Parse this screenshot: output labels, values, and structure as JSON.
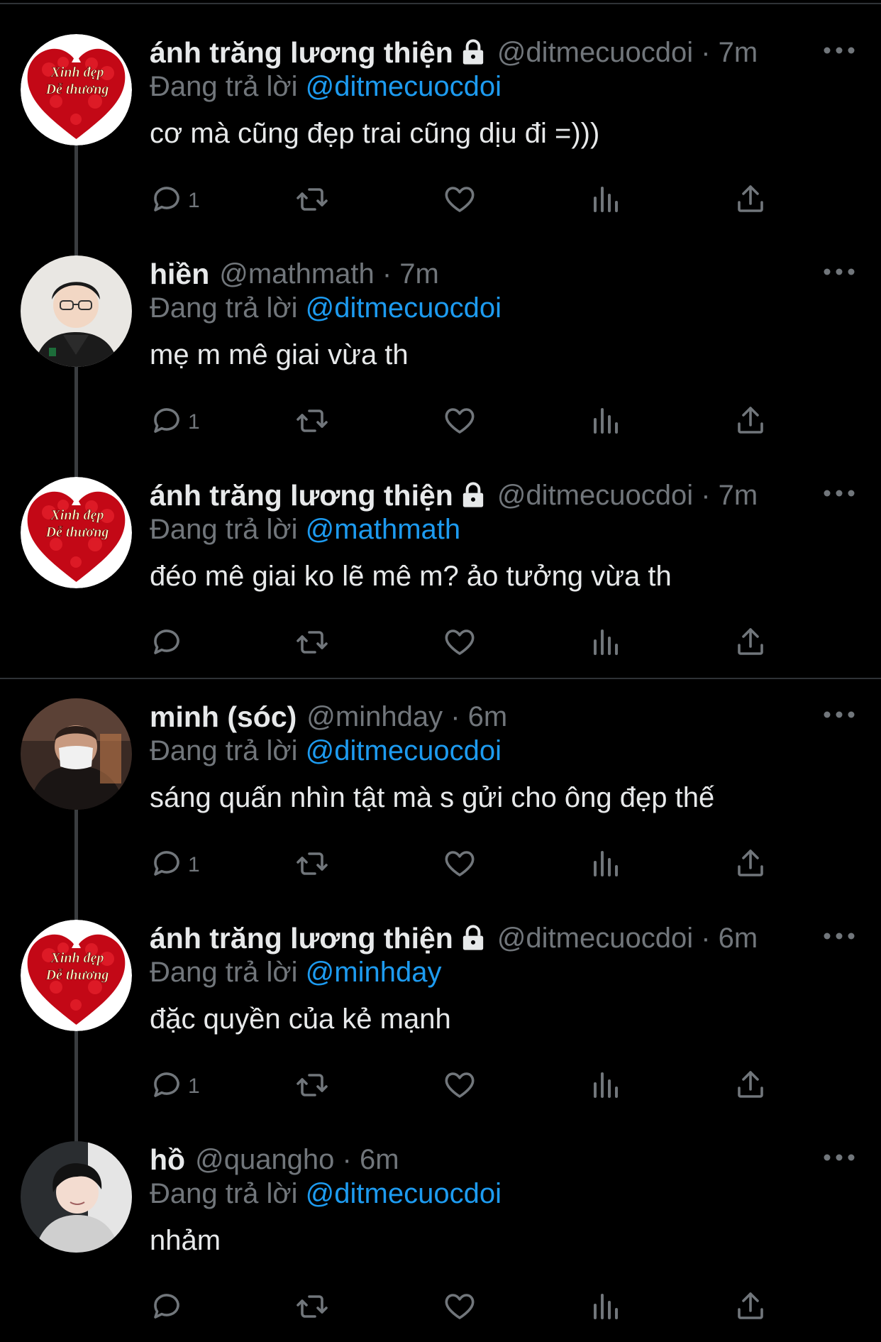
{
  "colors": {
    "background": "#000000",
    "text": "#e7e9ea",
    "muted": "#71767b",
    "link": "#1d9bf0",
    "icon": "#71767b"
  },
  "tweets": [
    {
      "name": "ánh trăng lương thiện",
      "locked": true,
      "meta": "@ditmecuocdoi · 7m",
      "reply_prefix": "Đang trả lời",
      "reply_handle": "@ditmecuocdoi",
      "text": "cơ mà cũng đẹp trai cũng dịu đi =)))",
      "reply_count": "1",
      "avatar": {
        "type": "heart-badge",
        "line1": "Xinh đẹp",
        "line2": "Dễ thương"
      }
    },
    {
      "name": "hiền",
      "locked": false,
      "meta": "@mathmath · 7m",
      "reply_prefix": "Đang trả lời",
      "reply_handle": "@ditmecuocdoi",
      "text": "mẹ m mê giai vừa th",
      "reply_count": "1",
      "avatar": {
        "type": "photo-person-glasses"
      }
    },
    {
      "name": "ánh trăng lương thiện",
      "locked": true,
      "meta": "@ditmecuocdoi · 7m",
      "reply_prefix": "Đang trả lời",
      "reply_handle": "@mathmath",
      "text": "đéo mê giai ko lẽ mê m? ảo tưởng vừa th",
      "reply_count": "",
      "avatar": {
        "type": "heart-badge",
        "line1": "Xinh đẹp",
        "line2": "Dễ thương"
      }
    },
    {
      "name": "minh (sóc)",
      "locked": false,
      "meta": "@minhday · 6m",
      "reply_prefix": "Đang trả lời",
      "reply_handle": "@ditmecuocdoi",
      "text": "sáng quấn nhìn tật mà s gửi cho ông đẹp thế",
      "reply_count": "1",
      "avatar": {
        "type": "photo-person-mask"
      }
    },
    {
      "name": "ánh trăng lương thiện",
      "locked": true,
      "meta": "@ditmecuocdoi · 6m",
      "reply_prefix": "Đang trả lời",
      "reply_handle": "@minhday",
      "text": "đặc quyền của kẻ mạnh",
      "reply_count": "1",
      "avatar": {
        "type": "heart-badge",
        "line1": "Xinh đẹp",
        "line2": "Dễ thương"
      }
    },
    {
      "name": "hồ",
      "locked": false,
      "meta": "@quangho · 6m",
      "reply_prefix": "Đang trả lời",
      "reply_handle": "@ditmecuocdoi",
      "text": "nhảm",
      "reply_count": "",
      "avatar": {
        "type": "photo-person-hoodie"
      }
    }
  ],
  "icons": [
    "reply-icon",
    "retweet-icon",
    "like-icon",
    "views-icon",
    "share-icon",
    "more-icon",
    "lock-icon"
  ]
}
